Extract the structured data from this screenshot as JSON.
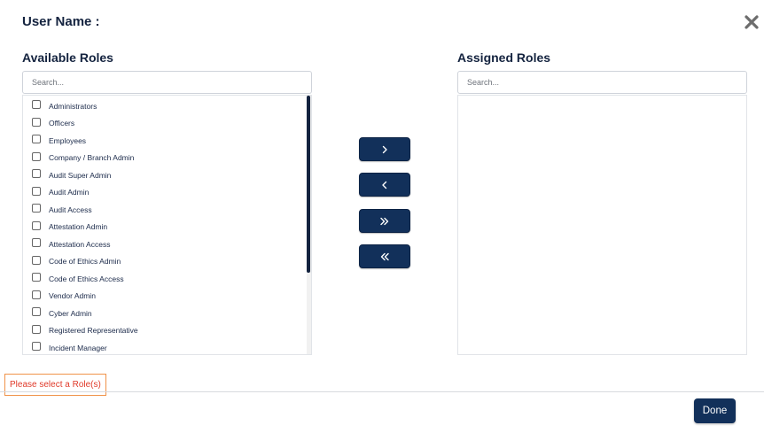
{
  "header": {
    "user_name_label": "User Name :"
  },
  "available": {
    "title": "Available Roles",
    "search_placeholder": "Search...",
    "roles": [
      "Administrators",
      "Officers",
      "Employees",
      "Company / Branch Admin",
      "Audit Super Admin",
      "Audit Admin",
      "Audit Access",
      "Attestation Admin",
      "Attestation Access",
      "Code of Ethics Admin",
      "Code of Ethics Access",
      "Vendor Admin",
      "Cyber Admin",
      "Registered Representative",
      "Incident Manager"
    ]
  },
  "assigned": {
    "title": "Assigned Roles",
    "search_placeholder": "Search...",
    "roles": []
  },
  "move_buttons": {
    "move_selected_right": "›",
    "move_selected_left": "‹",
    "move_all_right": "»",
    "move_all_left": "«"
  },
  "validation_message": "Please select a Role(s)",
  "footer": {
    "done_label": "Done"
  },
  "colors": {
    "primary": "#12305a",
    "heading": "#14233f",
    "error_text": "#e03a2a",
    "error_border": "#f0934a"
  },
  "icons": {
    "close": "close-icon",
    "move_right": "chevron-right-icon",
    "move_left": "chevron-left-icon",
    "move_all_right": "double-chevron-right-icon",
    "move_all_left": "double-chevron-left-icon"
  }
}
